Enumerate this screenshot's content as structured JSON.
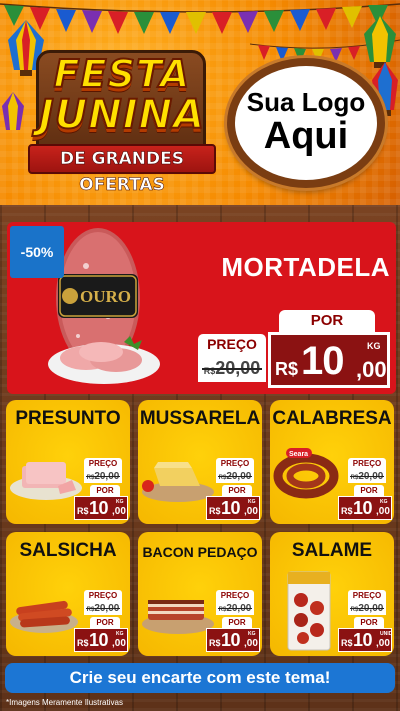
{
  "header": {
    "festa_line1": "FESTA",
    "festa_line2": "JUNINA",
    "ribbon": "DE GRANDES OFERTAS",
    "logo_line1": "Sua Logo",
    "logo_line2": "Aqui"
  },
  "featured": {
    "discount": "-50%",
    "name": "MORTADELA",
    "brand": "OURO",
    "preco_label": "PREÇO",
    "old_currency": "R$",
    "old_price": "20,00",
    "por_label": "POR",
    "new_currency": "R$",
    "new_int": "10",
    "new_cents": ",00",
    "unit": "KG"
  },
  "items": [
    {
      "name": "PRESUNTO",
      "preco_label": "PREÇO",
      "old_currency": "R$",
      "old_price": "20,00",
      "por_label": "POR",
      "new_currency": "R$",
      "new_int": "10",
      "new_cents": ",00",
      "unit": "KG"
    },
    {
      "name": "MUSSARELA",
      "preco_label": "PREÇO",
      "old_currency": "R$",
      "old_price": "20,00",
      "por_label": "POR",
      "new_currency": "R$",
      "new_int": "10",
      "new_cents": ",00",
      "unit": "KG"
    },
    {
      "name": "CALABRESA",
      "preco_label": "PREÇO",
      "old_currency": "R$",
      "old_price": "20,00",
      "por_label": "POR",
      "new_currency": "R$",
      "new_int": "10",
      "new_cents": ",00",
      "unit": "KG",
      "brand": "Seara"
    },
    {
      "name": "SALSICHA",
      "preco_label": "PREÇO",
      "old_currency": "R$",
      "old_price": "20,00",
      "por_label": "POR",
      "new_currency": "R$",
      "new_int": "10",
      "new_cents": ",00",
      "unit": "KG"
    },
    {
      "name": "BACON PEDAÇO",
      "preco_label": "PREÇO",
      "old_currency": "R$",
      "old_price": "20,00",
      "por_label": "POR",
      "new_currency": "R$",
      "new_int": "10",
      "new_cents": ",00",
      "unit": "KG"
    },
    {
      "name": "SALAME",
      "preco_label": "PREÇO",
      "old_currency": "R$",
      "old_price": "20,00",
      "por_label": "POR",
      "new_currency": "R$",
      "new_int": "10",
      "new_cents": ",00",
      "unit": "UNID"
    }
  ],
  "cta_label": "Crie seu encarte com este tema!",
  "disclaimer": "*Imagens Meramente Ilustrativas",
  "colors": {
    "header_orange": "#f58a00",
    "featured_red": "#d8141b",
    "price_dark_red": "#8b1212",
    "item_yellow": "#ffd10a",
    "cta_blue": "#1c76d4",
    "discount_blue": "#1a73c9",
    "wood_brown": "#6b3a1e"
  },
  "icons": [
    "bunting-flags",
    "balloon-lantern",
    "mortadela-image",
    "ham-image",
    "cheese-image",
    "sausage-image",
    "hotdog-image",
    "bacon-image",
    "salami-image"
  ]
}
